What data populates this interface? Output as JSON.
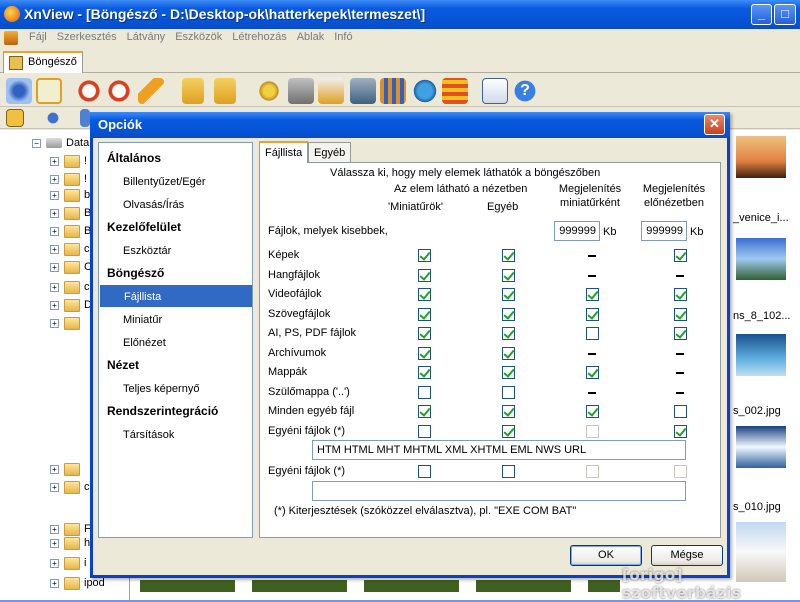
{
  "window": {
    "title": "XnView - [Böngésző - D:\\Desktop-ok\\hatterkepek\\termeszet\\]"
  },
  "menu": [
    "Fájl",
    "Szerkesztés",
    "Látvány",
    "Eszközök",
    "Létrehozás",
    "Ablak",
    "Infó"
  ],
  "browser_tab": "Böngésző",
  "tree": {
    "root": "Data",
    "items": [
      "!",
      "!",
      "b",
      "B",
      "B",
      "c",
      "C",
      "c",
      "D",
      "",
      "",
      "c",
      "F",
      "h",
      "i",
      "ipod"
    ]
  },
  "thumbs": {
    "captions": [
      "_venice_i...",
      "ns_8_102...",
      "s_002.jpg",
      "s_010.jpg"
    ]
  },
  "dialog": {
    "title": "Opciók",
    "nav": [
      {
        "type": "head",
        "label": "Általános"
      },
      {
        "type": "item",
        "label": "Billentyűzet/Egér"
      },
      {
        "type": "item",
        "label": "Olvasás/Írás"
      },
      {
        "type": "head",
        "label": "Kezelőfelület"
      },
      {
        "type": "item",
        "label": "Eszköztár"
      },
      {
        "type": "head",
        "label": "Böngésző"
      },
      {
        "type": "item",
        "label": "Fájllista",
        "selected": true
      },
      {
        "type": "item",
        "label": "Miniatűr"
      },
      {
        "type": "item",
        "label": "Előnézet"
      },
      {
        "type": "head",
        "label": "Nézet"
      },
      {
        "type": "item",
        "label": "Teljes képernyő"
      },
      {
        "type": "head",
        "label": "Rendszerintegráció"
      },
      {
        "type": "item",
        "label": "Társítások"
      }
    ],
    "tabs": [
      "Fájllista",
      "Egyéb"
    ],
    "intro": "Válassza ki, hogy mely elemek láthatók a böngészőben",
    "col_group": "Az elem látható a nézetben",
    "col_thumb_mode": "'Miniatűrök'",
    "col_other": "Egyéb",
    "col_show_thumb_1": "Megjelenítés",
    "col_show_thumb_2": "miniatűrként",
    "col_show_preview_1": "Megjelenítés",
    "col_show_preview_2": "előnézetben",
    "size_label": "Fájlok, melyek kisebbek,",
    "size_thumb": "999999",
    "size_preview": "999999",
    "unit": "Kb",
    "rows": [
      {
        "label": "Képek",
        "c": [
          "checked",
          "checked",
          "dash",
          "checked"
        ]
      },
      {
        "label": "Hangfájlok",
        "c": [
          "checked",
          "checked",
          "dash",
          "dash"
        ]
      },
      {
        "label": "Videofájlok",
        "c": [
          "checked",
          "checked",
          "checked",
          "checked"
        ]
      },
      {
        "label": "Szövegfájlok",
        "c": [
          "checked",
          "checked",
          "checked",
          "checked"
        ]
      },
      {
        "label": "AI, PS, PDF fájlok",
        "c": [
          "checked",
          "checked",
          "unchecked",
          "checked"
        ]
      },
      {
        "label": "Archívumok",
        "c": [
          "checked",
          "checked",
          "dash",
          "dash"
        ]
      },
      {
        "label": "Mappák",
        "c": [
          "checked",
          "checked",
          "checked",
          "dash"
        ]
      },
      {
        "label": "Szülőmappa ('..')",
        "c": [
          "unchecked",
          "unchecked",
          "dash",
          "dash"
        ]
      },
      {
        "label": "Minden egyéb fájl",
        "c": [
          "checked",
          "checked",
          "checked",
          "unchecked"
        ]
      },
      {
        "label": "Egyéni fájlok (*)",
        "c": [
          "unchecked",
          "checked",
          "disabled",
          "checked"
        ]
      }
    ],
    "custom1_ext": "HTM HTML MHT MHTML XML XHTML EML NWS URL",
    "custom2_label": "Egyéni fájlok (*)",
    "custom2_c": [
      "unchecked",
      "unchecked",
      "disabled",
      "disabled"
    ],
    "custom2_ext": "",
    "footnote": "(*) Kiterjesztések (szóközzel elválasztva), pl. \"EXE COM BAT\"",
    "ok": "OK",
    "cancel": "Mégse"
  },
  "watermark": "[origo] szoftverbázis"
}
